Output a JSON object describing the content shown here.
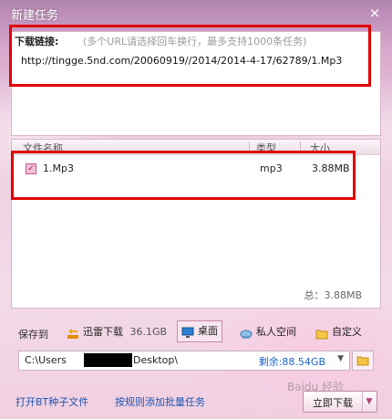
{
  "window": {
    "title": "新建任务",
    "close_symbol": "×"
  },
  "url_section": {
    "label": "下载链接:",
    "hint": "(多个URL请选择回车换行，最多支持1000条任务)",
    "url": "http://tingge.5nd.com/20060919//2014/2014-4-17/62789/1.Mp3"
  },
  "file_list": {
    "headers": {
      "name": "文件名称",
      "type": "类型",
      "size": "大小"
    },
    "rows": [
      {
        "checked": true,
        "name": "1.Mp3",
        "type": "mp3",
        "size": "3.88MB"
      }
    ],
    "total": "总：3.88MB"
  },
  "save": {
    "label": "保存到",
    "options": [
      {
        "label": "迅雷下载",
        "extra": "36.1GB"
      },
      {
        "label": "桌面"
      },
      {
        "label": "私人空间"
      },
      {
        "label": "自定义"
      }
    ],
    "path": {
      "prefix": "C:\\Users",
      "suffix": "Desktop\\",
      "free": "剩余:88.54GB"
    }
  },
  "footer": {
    "link_bt": "打开BT种子文件",
    "link_batch": "按规则添加批量任务",
    "download_button": "立即下载",
    "watermark": "Baidu 经验"
  },
  "colors": {
    "highlight_box": "#e00000",
    "link": "#1c56b4"
  }
}
